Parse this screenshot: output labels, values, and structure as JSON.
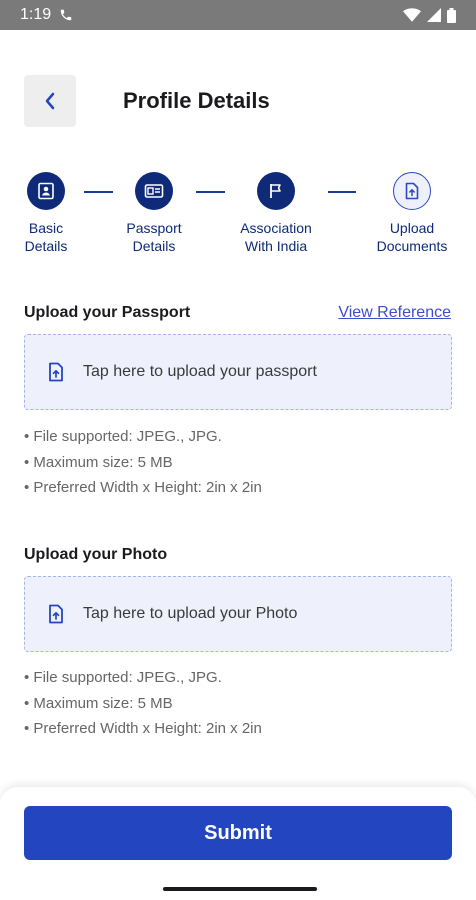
{
  "status_bar": {
    "time": "1:19"
  },
  "header": {
    "title": "Profile Details"
  },
  "stepper": {
    "steps": [
      {
        "label": "Basic\nDetails",
        "state": "done",
        "icon": "id-card-icon"
      },
      {
        "label": "Passport\nDetails",
        "state": "done",
        "icon": "passport-card-icon"
      },
      {
        "label": "Association\nWith India",
        "state": "done",
        "icon": "flag-icon"
      },
      {
        "label": "Upload\nDocuments",
        "state": "current",
        "icon": "upload-document-icon"
      }
    ]
  },
  "passport": {
    "title": "Upload your Passport",
    "view_reference": "View Reference",
    "upload_text": "Tap here to upload your passport",
    "rules": [
      "• File supported: JPEG., JPG.",
      "• Maximum size: 5 MB",
      "• Preferred Width x Height: 2in x 2in"
    ]
  },
  "photo": {
    "title": "Upload your Photo",
    "upload_text": "Tap here to upload your Photo",
    "rules": [
      "• File supported: JPEG., JPG.",
      "• Maximum size: 5 MB",
      "• Preferred Width x Height: 2in x 2in"
    ]
  },
  "footer": {
    "submit_label": "Submit"
  },
  "colors": {
    "primary": "#2346c0",
    "step_done": "#0e2a78",
    "link": "#3c4fc6",
    "upload_bg": "#eef1fc"
  }
}
